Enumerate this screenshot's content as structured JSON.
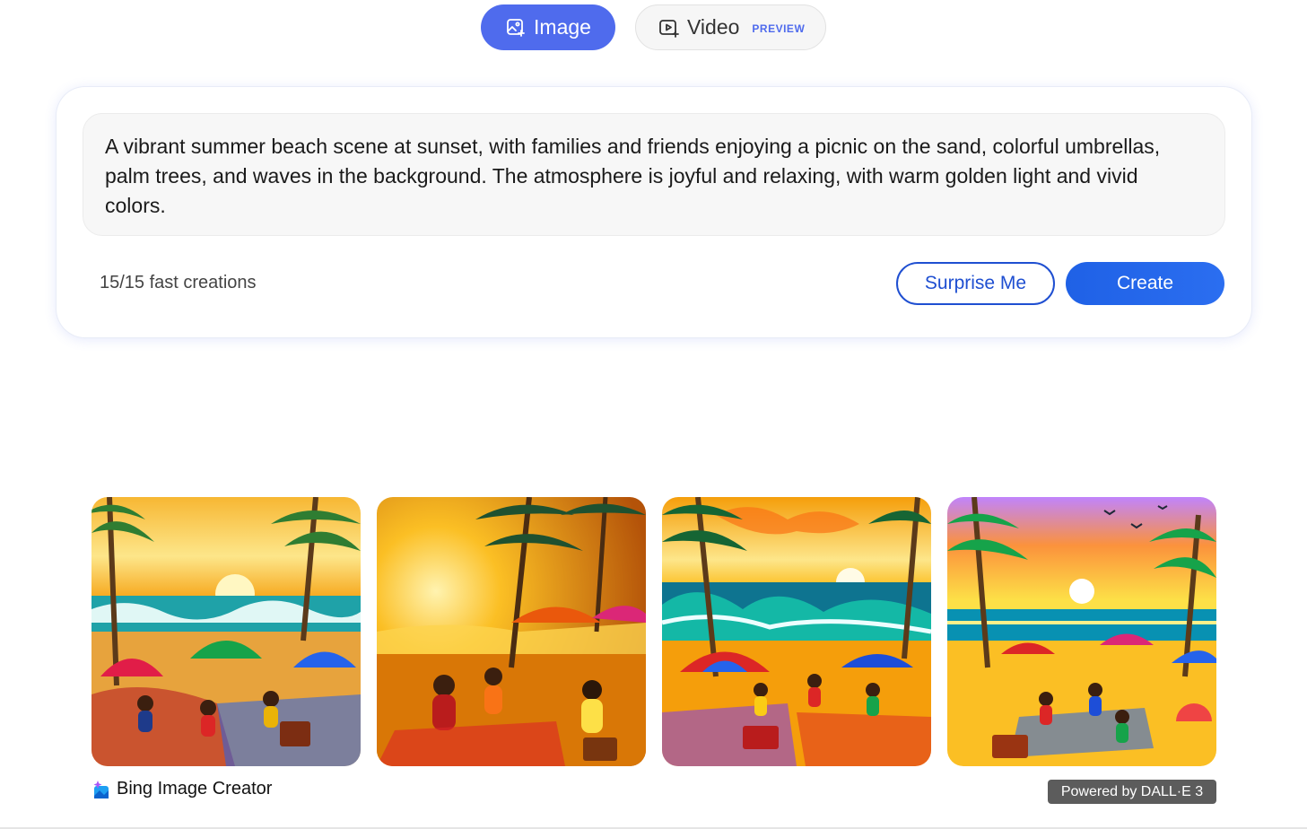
{
  "mode_tabs": {
    "image_label": "Image",
    "video_label": "Video",
    "video_badge": "PREVIEW",
    "active": "Image"
  },
  "prompt": {
    "text": "A vibrant summer beach scene at sunset, with families and friends enjoying a picnic on the sand, colorful umbrellas, palm trees, and waves in the background. The atmosphere is joyful and relaxing, with warm golden light and vivid colors."
  },
  "actions": {
    "fast_creations": "15/15 fast creations",
    "surprise_label": "Surprise Me",
    "create_label": "Create"
  },
  "results": {
    "images": [
      {
        "subject": "beach picnic at sunset, palm trees, umbrellas"
      },
      {
        "subject": "golden sunset beach picnic under palms"
      },
      {
        "subject": "stylized beach scene with waves and umbrellas"
      },
      {
        "subject": "bright sunset beach with families and picnic blankets"
      }
    ]
  },
  "footer": {
    "brand": "Bing Image Creator",
    "powered_by": "Powered by DALL·E 3"
  },
  "colors": {
    "accent": "#4f6bed",
    "create_button": "#1f61e6",
    "surprise_border": "#1f4fd1"
  }
}
